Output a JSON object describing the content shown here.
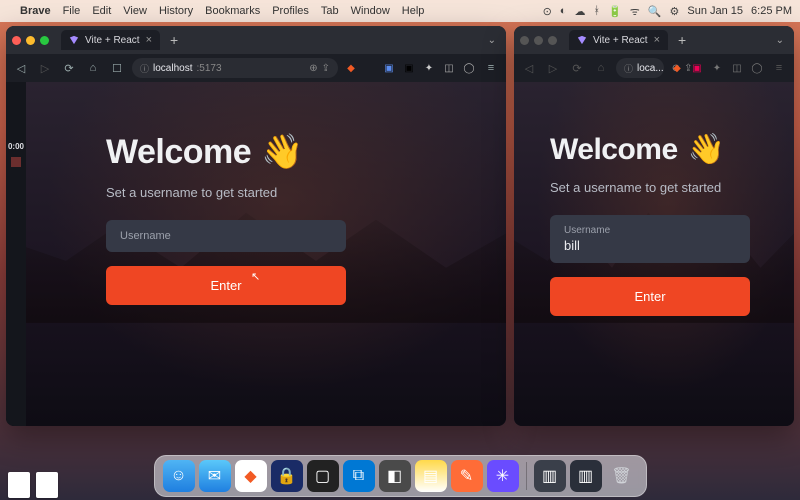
{
  "menubar": {
    "app": "Brave",
    "items": [
      "File",
      "Edit",
      "View",
      "History",
      "Bookmarks",
      "Profiles",
      "Tab",
      "Window",
      "Help"
    ],
    "status": {
      "date": "Sun Jan 15",
      "time": "6:25 PM"
    }
  },
  "windows": [
    {
      "id": "left",
      "tab_title": "Vite + React",
      "url_host": "localhost",
      "url_path": ":5173",
      "sidebar_time": "0:00",
      "form": {
        "heading": "Welcome",
        "emoji": "👋",
        "subtitle": "Set a username to get started",
        "field_label": "Username",
        "field_value": "",
        "button": "Enter"
      }
    },
    {
      "id": "right",
      "tab_title": "Vite + React",
      "tab_title_short": "loca...",
      "form": {
        "heading": "Welcome",
        "emoji": "👋",
        "subtitle": "Set a username to get started",
        "field_label": "Username",
        "field_value": "bill",
        "button": "Enter"
      }
    }
  ],
  "colors": {
    "accent": "#ef4623",
    "input_bg": "#353946",
    "page_bg": "#1a1d25"
  }
}
